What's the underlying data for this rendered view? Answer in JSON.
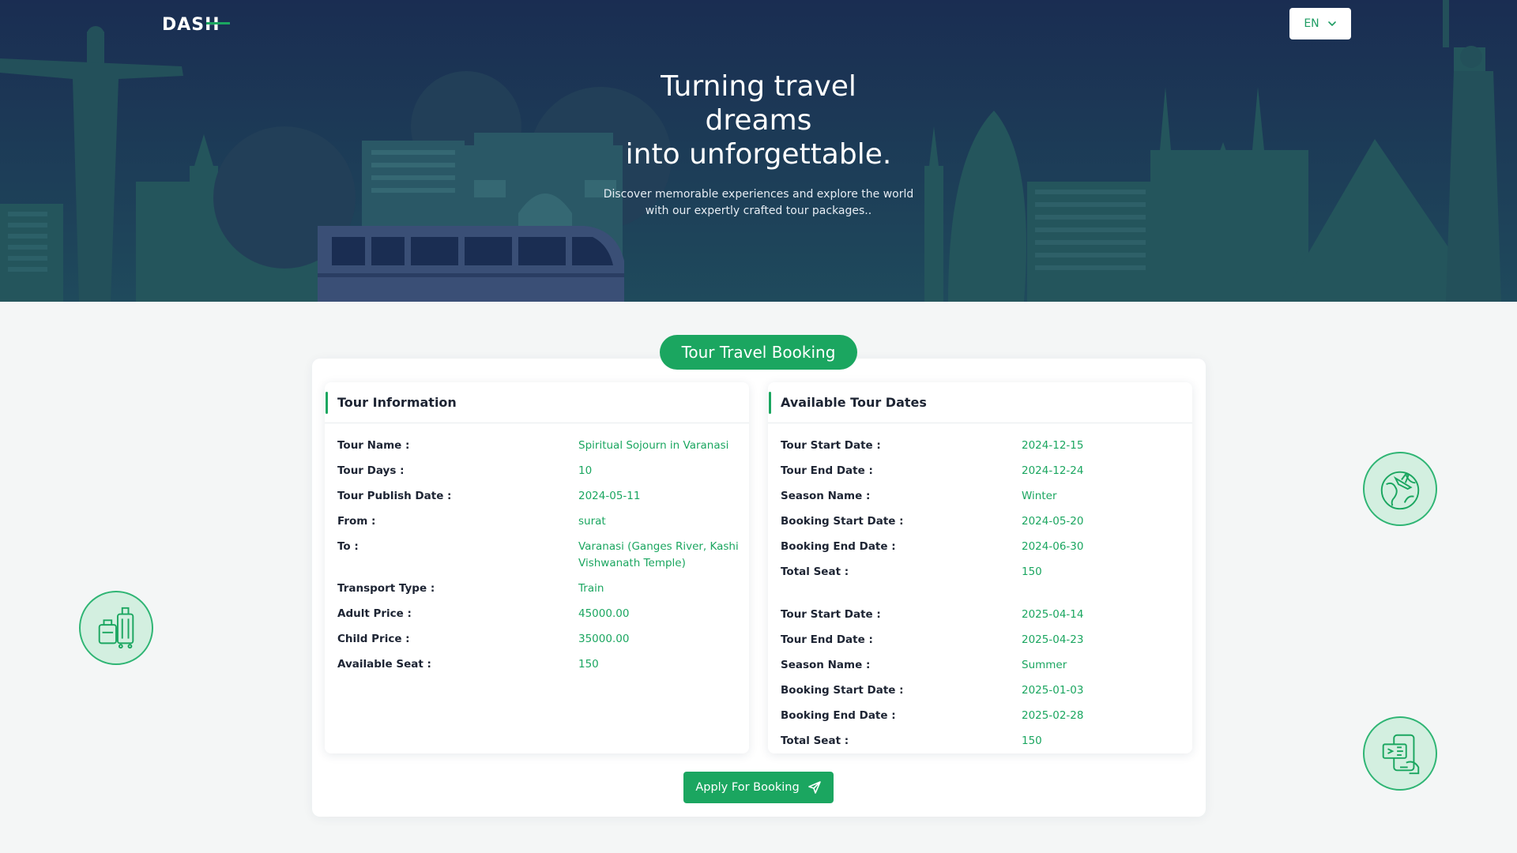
{
  "header": {
    "logo_text": "DASH",
    "language": "EN"
  },
  "hero": {
    "title_line1": "Turning travel",
    "title_line2": "dreams",
    "title_line3": "into unforgettable.",
    "subtitle": "Discover memorable experiences and explore the world with our expertly crafted tour packages.."
  },
  "booking": {
    "badge": "Tour Travel Booking",
    "apply_label": "Apply For Booking"
  },
  "tour_info": {
    "title": "Tour Information",
    "rows": [
      {
        "label": "Tour Name :",
        "value": "Spiritual Sojourn in Varanasi"
      },
      {
        "label": "Tour Days :",
        "value": "10"
      },
      {
        "label": "Tour Publish Date :",
        "value": "2024-05-11"
      },
      {
        "label": "From :",
        "value": "surat"
      },
      {
        "label": "To :",
        "value": "Varanasi (Ganges River, Kashi Vishwanath Temple)"
      },
      {
        "label": "Transport Type :",
        "value": "Train"
      },
      {
        "label": "Adult Price :",
        "value": "45000.00"
      },
      {
        "label": "Child Price :",
        "value": "35000.00"
      },
      {
        "label": "Available Seat :",
        "value": "150"
      }
    ]
  },
  "tour_dates": {
    "title": "Available Tour Dates",
    "groups": [
      {
        "rows": [
          {
            "label": "Tour Start Date :",
            "value": "2024-12-15"
          },
          {
            "label": "Tour End Date :",
            "value": "2024-12-24"
          },
          {
            "label": "Season Name :",
            "value": "Winter"
          },
          {
            "label": "Booking Start Date :",
            "value": "2024-05-20"
          },
          {
            "label": "Booking End Date :",
            "value": "2024-06-30"
          },
          {
            "label": "Total Seat :",
            "value": "150"
          }
        ]
      },
      {
        "rows": [
          {
            "label": "Tour Start Date :",
            "value": "2025-04-14"
          },
          {
            "label": "Tour End Date :",
            "value": "2025-04-23"
          },
          {
            "label": "Season Name :",
            "value": "Summer"
          },
          {
            "label": "Booking Start Date :",
            "value": "2025-01-03"
          },
          {
            "label": "Booking End Date :",
            "value": "2025-02-28"
          },
          {
            "label": "Total Seat :",
            "value": "150"
          }
        ]
      }
    ]
  },
  "icons": {
    "chevron": "chevron-down-icon",
    "send": "paper-plane-icon",
    "luggage": "luggage-icon",
    "globe": "globe-plane-icon",
    "ticket": "phone-ticket-icon"
  },
  "colors": {
    "hero_bg": "#1a2d52",
    "accent": "#1ba660",
    "accent_light": "#d3efe0",
    "page_bg": "#f4f6f6"
  }
}
